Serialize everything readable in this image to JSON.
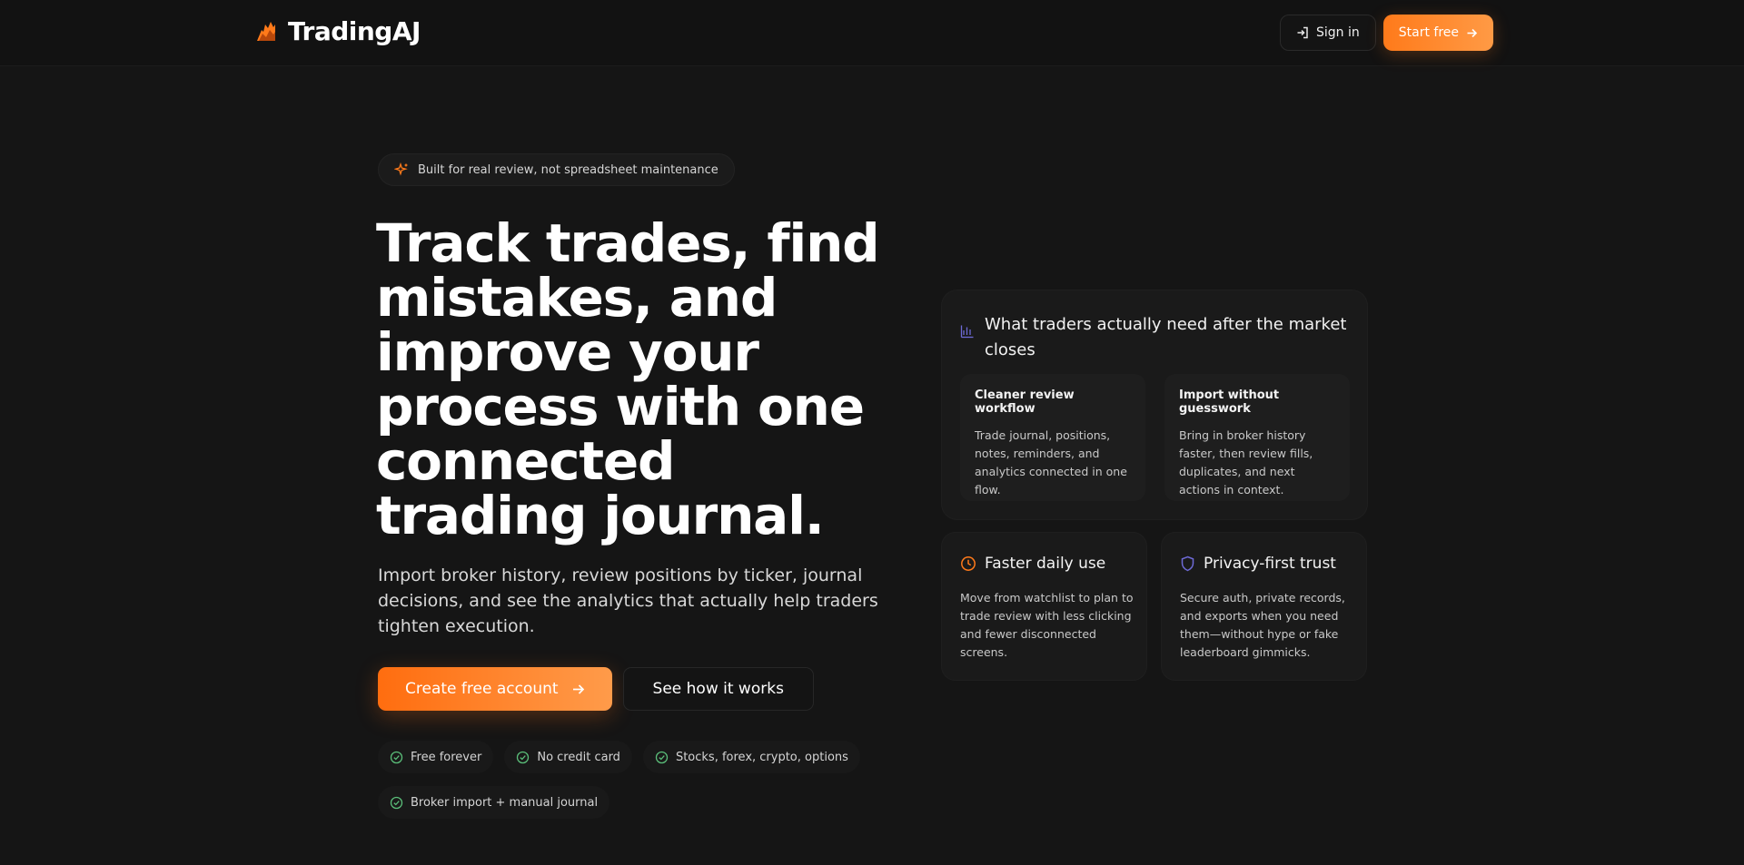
{
  "colors": {
    "accent": "#ff7a1a",
    "check": "#5bbf7a",
    "shield": "#6e6ad6",
    "chart": "#6e6ad6"
  },
  "header": {
    "brand_name": "TradingAJ",
    "signin_label": "Sign in",
    "startfree_label": "Start free"
  },
  "hero": {
    "pill_text": "Built for real review, not spreadsheet maintenance",
    "headline": "Track trades, find mistakes, and improve your process with one connected trading journal.",
    "subline": "Import broker history, review positions by ticker, journal decisions, and see the analytics that actually help traders tighten execution.",
    "create_label": "Create free account",
    "how_label": "See how it works",
    "tags": [
      "Free forever",
      "No credit card",
      "Stocks, forex, crypto, options",
      "Broker import + manual journal"
    ]
  },
  "panel": {
    "title": "What traders actually need after the market closes",
    "cards": [
      {
        "head": "Cleaner review workflow",
        "body": "Trade journal, positions, notes, reminders, and analytics connected in one flow."
      },
      {
        "head": "Import without guesswork",
        "body": "Bring in broker history faster, then review fills, duplicates, and next actions in context."
      }
    ]
  },
  "features": [
    {
      "head": "Faster daily use",
      "body": "Move from watchlist to plan to trade review with less clicking and fewer disconnected screens.",
      "icon": "clock-icon"
    },
    {
      "head": "Privacy-first trust",
      "body": "Secure auth, private records, and exports when you need them—without hype or fake leaderboard gimmicks.",
      "icon": "shield-icon"
    }
  ]
}
